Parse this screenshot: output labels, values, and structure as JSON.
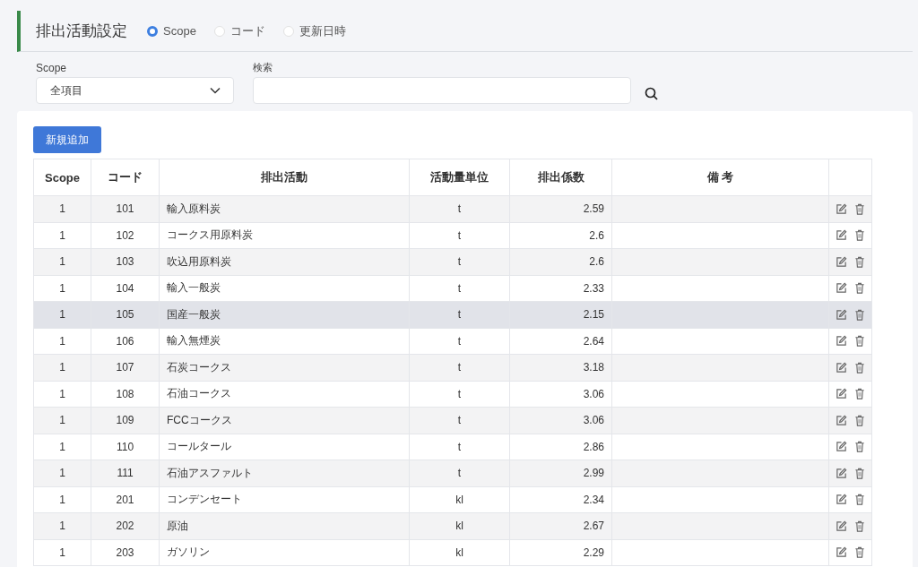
{
  "header": {
    "title": "排出活動設定",
    "sort_options": [
      {
        "label": "Scope",
        "selected": true
      },
      {
        "label": "コード",
        "selected": false
      },
      {
        "label": "更新日時",
        "selected": false
      }
    ]
  },
  "filters": {
    "scope": {
      "label": "Scope",
      "value": "全項目"
    },
    "search": {
      "label": "検索"
    }
  },
  "add_button": "新規追加",
  "table": {
    "columns": [
      "Scope",
      "コード",
      "排出活動",
      "活動量単位",
      "排出係数",
      "備 考"
    ],
    "rows": [
      {
        "scope": "1",
        "code": "101",
        "activity": "輸入原料炭",
        "unit": "t",
        "factor": "2.59",
        "hovered": false
      },
      {
        "scope": "1",
        "code": "102",
        "activity": "コークス用原料炭",
        "unit": "t",
        "factor": "2.6",
        "hovered": false
      },
      {
        "scope": "1",
        "code": "103",
        "activity": "吹込用原料炭",
        "unit": "t",
        "factor": "2.6",
        "hovered": false
      },
      {
        "scope": "1",
        "code": "104",
        "activity": "輸入一般炭",
        "unit": "t",
        "factor": "2.33",
        "hovered": false
      },
      {
        "scope": "1",
        "code": "105",
        "activity": "国産一般炭",
        "unit": "t",
        "factor": "2.15",
        "hovered": true
      },
      {
        "scope": "1",
        "code": "106",
        "activity": "輸入無煙炭",
        "unit": "t",
        "factor": "2.64",
        "hovered": false
      },
      {
        "scope": "1",
        "code": "107",
        "activity": "石炭コークス",
        "unit": "t",
        "factor": "3.18",
        "hovered": false
      },
      {
        "scope": "1",
        "code": "108",
        "activity": "石油コークス",
        "unit": "t",
        "factor": "3.06",
        "hovered": false
      },
      {
        "scope": "1",
        "code": "109",
        "activity": "FCCコークス",
        "unit": "t",
        "factor": "3.06",
        "hovered": false
      },
      {
        "scope": "1",
        "code": "110",
        "activity": "コールタール",
        "unit": "t",
        "factor": "2.86",
        "hovered": false
      },
      {
        "scope": "1",
        "code": "111",
        "activity": "石油アスファルト",
        "unit": "t",
        "factor": "2.99",
        "hovered": false
      },
      {
        "scope": "1",
        "code": "201",
        "activity": "コンデンセート",
        "unit": "kl",
        "factor": "2.34",
        "hovered": false
      },
      {
        "scope": "1",
        "code": "202",
        "activity": "原油",
        "unit": "kl",
        "factor": "2.67",
        "hovered": false
      },
      {
        "scope": "1",
        "code": "203",
        "activity": "ガソリン",
        "unit": "kl",
        "factor": "2.29",
        "hovered": false
      }
    ]
  }
}
